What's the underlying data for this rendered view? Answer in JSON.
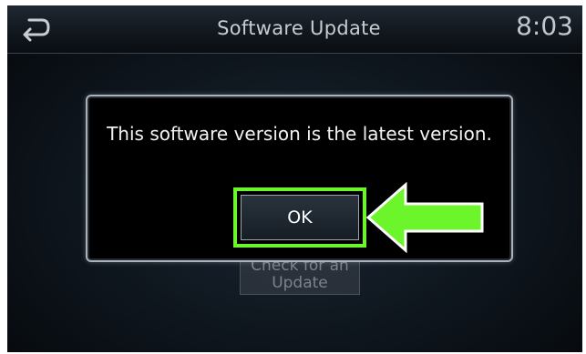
{
  "header": {
    "title": "Software Update",
    "clock": "8:03",
    "back_icon": "back-arrow-icon"
  },
  "background": {
    "check_update_button": {
      "line1": "Check for an",
      "line2": "Update"
    }
  },
  "dialog": {
    "message": "This software version is the latest version.",
    "ok_label": "OK"
  },
  "annotation": {
    "arrow_icon": "left-arrow-icon",
    "highlight_color": "#6cf52a"
  },
  "colors": {
    "screen_bg": "#101820",
    "text": "#f2f2f2",
    "dialog_border": "#aab2bb",
    "highlight": "#6cf52a"
  }
}
